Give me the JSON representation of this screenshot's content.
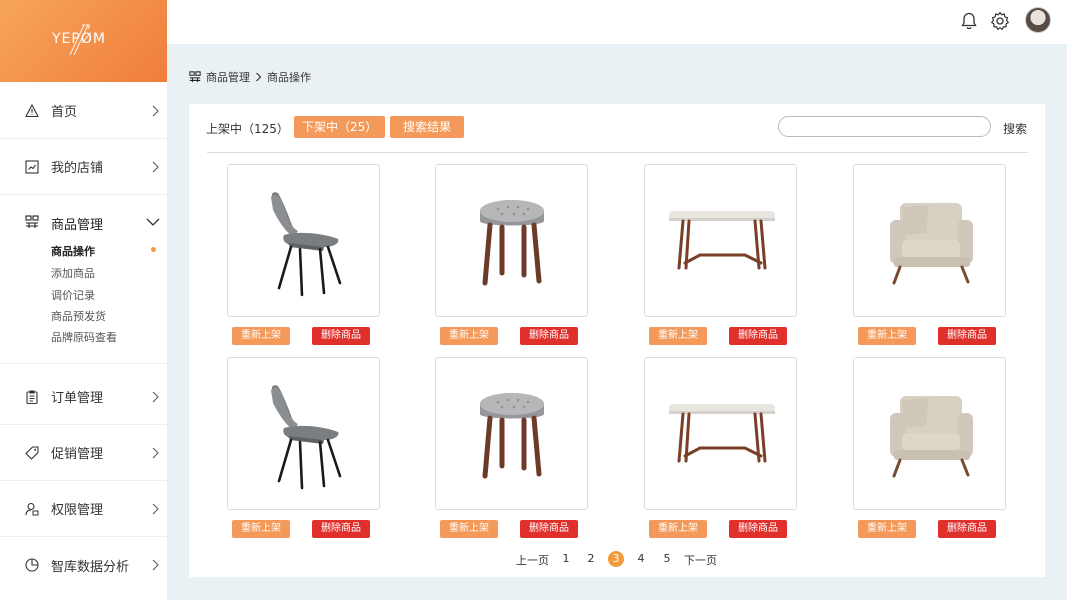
{
  "app": {
    "logo_text": "YEPØM"
  },
  "sidebar": {
    "items": [
      {
        "label": "首页",
        "icon": "warning-triangle-icon"
      },
      {
        "label": "我的店铺",
        "icon": "chart-box-icon"
      },
      {
        "label": "订单管理",
        "icon": "clipboard-icon"
      },
      {
        "label": "促销管理",
        "icon": "tag-icon"
      },
      {
        "label": "权限管理",
        "icon": "user-lock-icon"
      },
      {
        "label": "智库数据分析",
        "icon": "pie-chart-icon"
      }
    ],
    "group": {
      "label": "商品管理",
      "icon": "product-grid-icon",
      "sub_items": [
        "商品操作",
        "添加商品",
        "调价记录",
        "商品预发货",
        "品牌原码查看"
      ],
      "active_index": 0
    }
  },
  "topbar": {
    "icons": [
      "bell-icon",
      "gear-icon",
      "avatar"
    ]
  },
  "breadcrumb": {
    "parent": "商品管理",
    "current": "商品操作"
  },
  "toolbar": {
    "on_shelf": "上架中（125）",
    "off_shelf": "下架中（25）",
    "search_results": "搜索结果",
    "search_placeholder": "",
    "search_button": "搜索"
  },
  "products": [
    {
      "type": "chair",
      "relist_label": "重新上架",
      "delete_label": "删除商品"
    },
    {
      "type": "stool",
      "relist_label": "重新上架",
      "delete_label": "删除商品"
    },
    {
      "type": "table",
      "relist_label": "重新上架",
      "delete_label": "删除商品"
    },
    {
      "type": "armchair",
      "relist_label": "重新上架",
      "delete_label": "删除商品"
    },
    {
      "type": "chair",
      "relist_label": "重新上架",
      "delete_label": "删除商品"
    },
    {
      "type": "stool",
      "relist_label": "重新上架",
      "delete_label": "删除商品"
    },
    {
      "type": "table",
      "relist_label": "重新上架",
      "delete_label": "删除商品"
    },
    {
      "type": "armchair",
      "relist_label": "重新上架",
      "delete_label": "删除商品"
    }
  ],
  "pagination": {
    "prev": "上一页",
    "pages": [
      "1",
      "2",
      "3",
      "4",
      "5"
    ],
    "current": "3",
    "next": "下一页"
  },
  "colors": {
    "accent": "#f39a5a",
    "danger": "#e0302c",
    "background": "#eaf1f4"
  }
}
